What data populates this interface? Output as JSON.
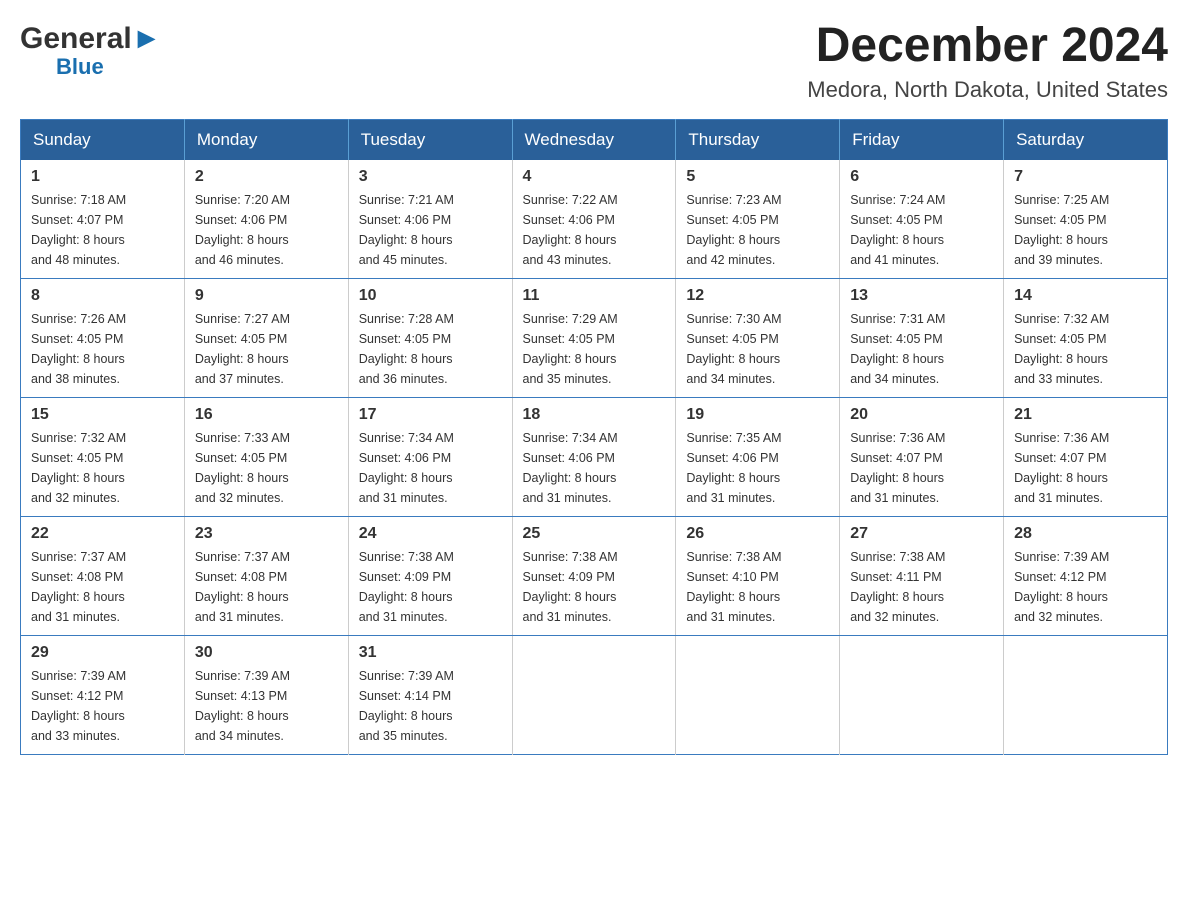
{
  "header": {
    "logo_general": "General",
    "logo_blue": "Blue",
    "month_title": "December 2024",
    "location": "Medora, North Dakota, United States"
  },
  "weekdays": [
    "Sunday",
    "Monday",
    "Tuesday",
    "Wednesday",
    "Thursday",
    "Friday",
    "Saturday"
  ],
  "weeks": [
    [
      {
        "day": "1",
        "sunrise": "7:18 AM",
        "sunset": "4:07 PM",
        "daylight": "8 hours and 48 minutes."
      },
      {
        "day": "2",
        "sunrise": "7:20 AM",
        "sunset": "4:06 PM",
        "daylight": "8 hours and 46 minutes."
      },
      {
        "day": "3",
        "sunrise": "7:21 AM",
        "sunset": "4:06 PM",
        "daylight": "8 hours and 45 minutes."
      },
      {
        "day": "4",
        "sunrise": "7:22 AM",
        "sunset": "4:06 PM",
        "daylight": "8 hours and 43 minutes."
      },
      {
        "day": "5",
        "sunrise": "7:23 AM",
        "sunset": "4:05 PM",
        "daylight": "8 hours and 42 minutes."
      },
      {
        "day": "6",
        "sunrise": "7:24 AM",
        "sunset": "4:05 PM",
        "daylight": "8 hours and 41 minutes."
      },
      {
        "day": "7",
        "sunrise": "7:25 AM",
        "sunset": "4:05 PM",
        "daylight": "8 hours and 39 minutes."
      }
    ],
    [
      {
        "day": "8",
        "sunrise": "7:26 AM",
        "sunset": "4:05 PM",
        "daylight": "8 hours and 38 minutes."
      },
      {
        "day": "9",
        "sunrise": "7:27 AM",
        "sunset": "4:05 PM",
        "daylight": "8 hours and 37 minutes."
      },
      {
        "day": "10",
        "sunrise": "7:28 AM",
        "sunset": "4:05 PM",
        "daylight": "8 hours and 36 minutes."
      },
      {
        "day": "11",
        "sunrise": "7:29 AM",
        "sunset": "4:05 PM",
        "daylight": "8 hours and 35 minutes."
      },
      {
        "day": "12",
        "sunrise": "7:30 AM",
        "sunset": "4:05 PM",
        "daylight": "8 hours and 34 minutes."
      },
      {
        "day": "13",
        "sunrise": "7:31 AM",
        "sunset": "4:05 PM",
        "daylight": "8 hours and 34 minutes."
      },
      {
        "day": "14",
        "sunrise": "7:32 AM",
        "sunset": "4:05 PM",
        "daylight": "8 hours and 33 minutes."
      }
    ],
    [
      {
        "day": "15",
        "sunrise": "7:32 AM",
        "sunset": "4:05 PM",
        "daylight": "8 hours and 32 minutes."
      },
      {
        "day": "16",
        "sunrise": "7:33 AM",
        "sunset": "4:05 PM",
        "daylight": "8 hours and 32 minutes."
      },
      {
        "day": "17",
        "sunrise": "7:34 AM",
        "sunset": "4:06 PM",
        "daylight": "8 hours and 31 minutes."
      },
      {
        "day": "18",
        "sunrise": "7:34 AM",
        "sunset": "4:06 PM",
        "daylight": "8 hours and 31 minutes."
      },
      {
        "day": "19",
        "sunrise": "7:35 AM",
        "sunset": "4:06 PM",
        "daylight": "8 hours and 31 minutes."
      },
      {
        "day": "20",
        "sunrise": "7:36 AM",
        "sunset": "4:07 PM",
        "daylight": "8 hours and 31 minutes."
      },
      {
        "day": "21",
        "sunrise": "7:36 AM",
        "sunset": "4:07 PM",
        "daylight": "8 hours and 31 minutes."
      }
    ],
    [
      {
        "day": "22",
        "sunrise": "7:37 AM",
        "sunset": "4:08 PM",
        "daylight": "8 hours and 31 minutes."
      },
      {
        "day": "23",
        "sunrise": "7:37 AM",
        "sunset": "4:08 PM",
        "daylight": "8 hours and 31 minutes."
      },
      {
        "day": "24",
        "sunrise": "7:38 AM",
        "sunset": "4:09 PM",
        "daylight": "8 hours and 31 minutes."
      },
      {
        "day": "25",
        "sunrise": "7:38 AM",
        "sunset": "4:09 PM",
        "daylight": "8 hours and 31 minutes."
      },
      {
        "day": "26",
        "sunrise": "7:38 AM",
        "sunset": "4:10 PM",
        "daylight": "8 hours and 31 minutes."
      },
      {
        "day": "27",
        "sunrise": "7:38 AM",
        "sunset": "4:11 PM",
        "daylight": "8 hours and 32 minutes."
      },
      {
        "day": "28",
        "sunrise": "7:39 AM",
        "sunset": "4:12 PM",
        "daylight": "8 hours and 32 minutes."
      }
    ],
    [
      {
        "day": "29",
        "sunrise": "7:39 AM",
        "sunset": "4:12 PM",
        "daylight": "8 hours and 33 minutes."
      },
      {
        "day": "30",
        "sunrise": "7:39 AM",
        "sunset": "4:13 PM",
        "daylight": "8 hours and 34 minutes."
      },
      {
        "day": "31",
        "sunrise": "7:39 AM",
        "sunset": "4:14 PM",
        "daylight": "8 hours and 35 minutes."
      },
      null,
      null,
      null,
      null
    ]
  ],
  "labels": {
    "sunrise": "Sunrise:",
    "sunset": "Sunset:",
    "daylight": "Daylight:"
  }
}
